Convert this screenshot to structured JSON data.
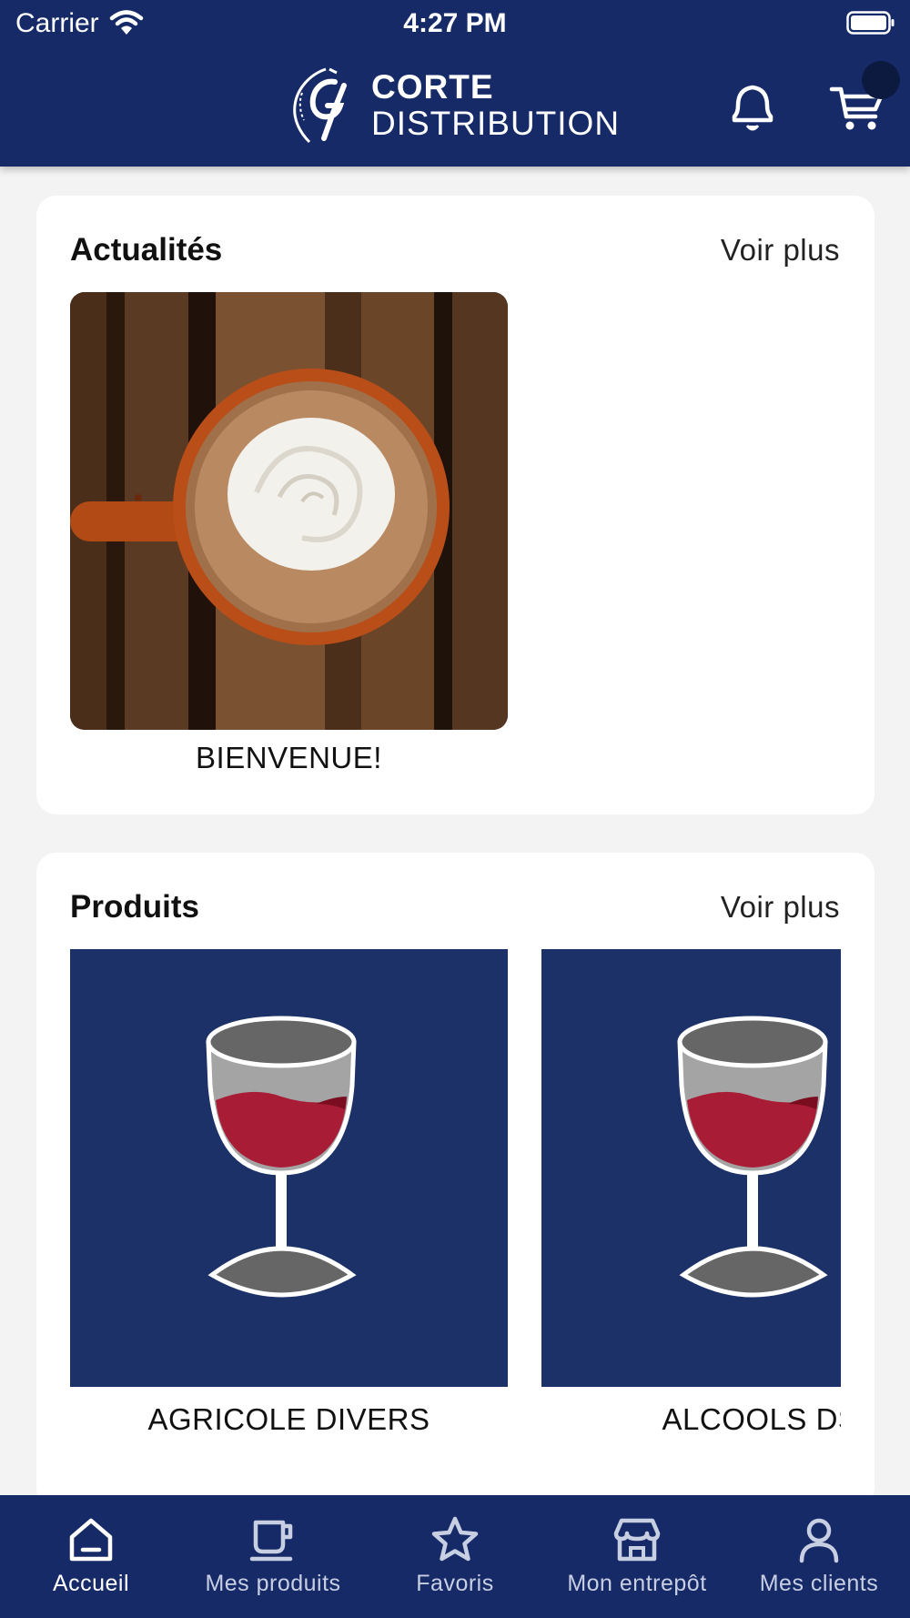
{
  "status_bar": {
    "carrier": "Carrier",
    "time": "4:27 PM"
  },
  "header": {
    "logo_line1": "CORTE",
    "logo_line2": "DISTRIBUTION",
    "background": "#172a68",
    "notification_icon": "bell-icon",
    "cart_icon": "cart-icon"
  },
  "news": {
    "title": "Actualités",
    "more_label": "Voir plus",
    "items": [
      {
        "caption": "BIENVENUE!"
      }
    ]
  },
  "products": {
    "title": "Produits",
    "more_label": "Voir plus",
    "items": [
      {
        "caption": "AGRICOLE DIVERS"
      },
      {
        "caption": "ALCOOLS DS"
      }
    ]
  },
  "tabbar": {
    "tabs": [
      {
        "label": "Accueil",
        "icon": "home-icon",
        "active": true
      },
      {
        "label": "Mes produits",
        "icon": "cup-icon",
        "active": false
      },
      {
        "label": "Favoris",
        "icon": "star-icon",
        "active": false
      },
      {
        "label": "Mon entrepôt",
        "icon": "store-icon",
        "active": false
      },
      {
        "label": "Mes clients",
        "icon": "user-icon",
        "active": false
      }
    ]
  }
}
